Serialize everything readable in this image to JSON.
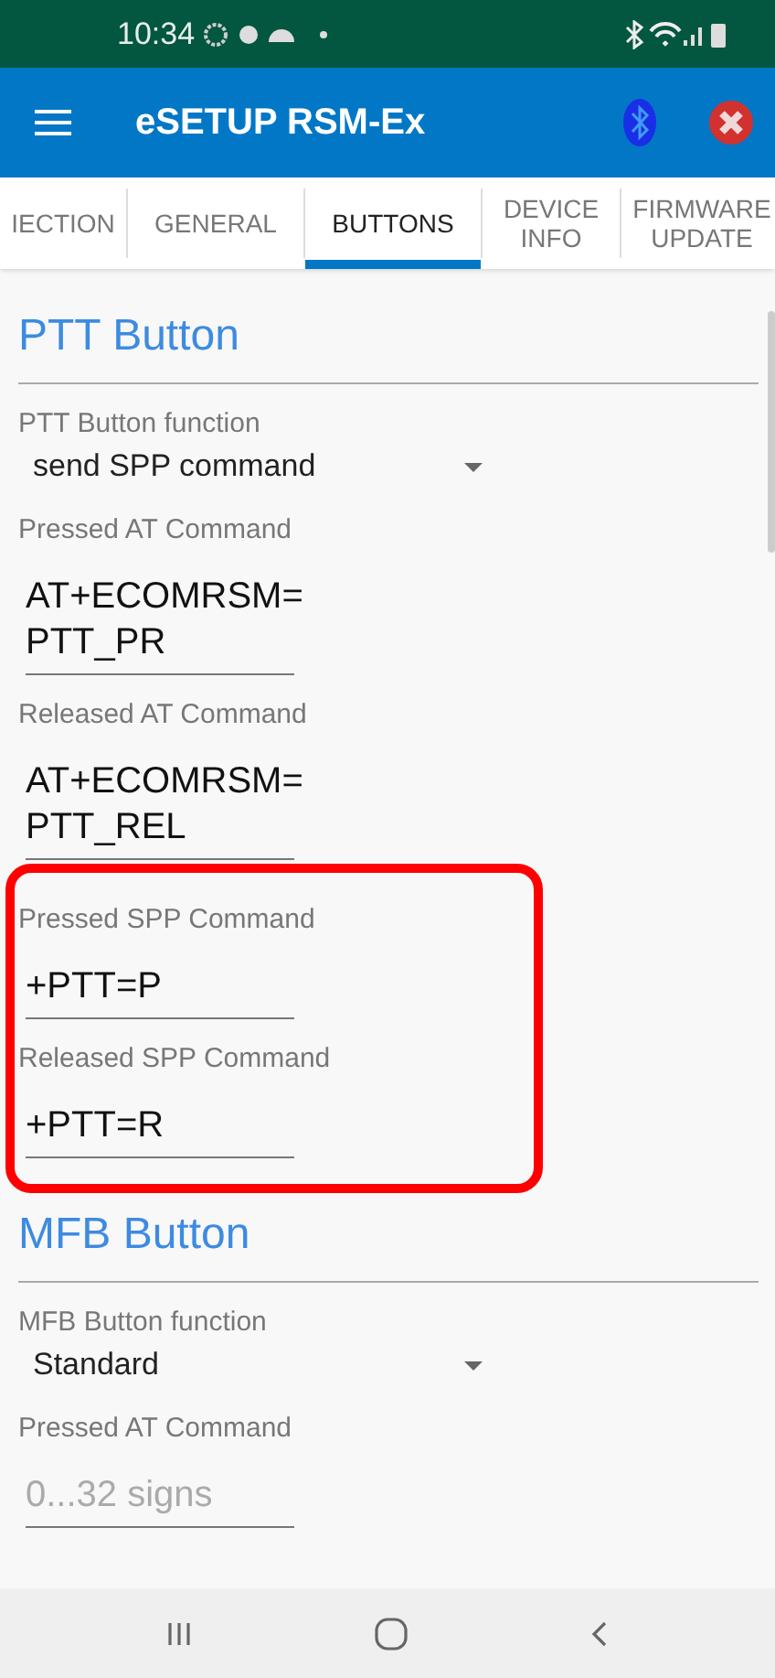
{
  "status_bar": {
    "time": "10:34"
  },
  "app_bar": {
    "title": "eSETUP RSM-Ex"
  },
  "tabs": [
    {
      "label": "IECTION",
      "selected": false
    },
    {
      "label": "GENERAL",
      "selected": false
    },
    {
      "label": "BUTTONS",
      "selected": true
    },
    {
      "label": "DEVICE INFO",
      "selected": false
    },
    {
      "label": "FIRMWARE UPDATE",
      "selected": false
    }
  ],
  "sections": [
    {
      "title": "PTT Button",
      "items": [
        {
          "kind": "dropdown",
          "label": "PTT Button function",
          "value": "send SPP command"
        },
        {
          "kind": "input",
          "label": "Pressed AT Command",
          "value": "AT+ECOMRSM=\nPTT_PR"
        },
        {
          "kind": "input",
          "label": "Released AT Command",
          "value": "AT+ECOMRSM=\nPTT_REL"
        },
        {
          "kind": "highlight",
          "items": [
            {
              "kind": "input",
              "label": "Pressed SPP Command",
              "value": "+PTT=P"
            },
            {
              "kind": "input",
              "label": "Released SPP Command",
              "value": "+PTT=R"
            }
          ]
        }
      ]
    },
    {
      "title": "MFB Button",
      "items": [
        {
          "kind": "dropdown",
          "label": "MFB Button function",
          "value": "Standard"
        },
        {
          "kind": "input",
          "label": "Pressed AT Command",
          "placeholder": "0...32 signs"
        }
      ]
    }
  ]
}
